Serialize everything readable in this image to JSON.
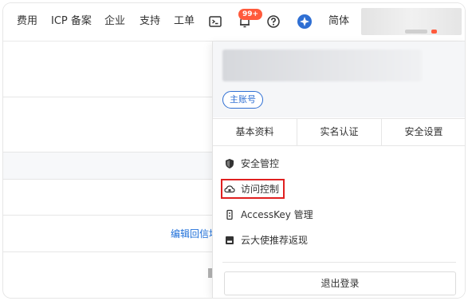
{
  "topbar": {
    "nav": [
      "费用",
      "ICP 备案",
      "企业",
      "支持",
      "工单"
    ],
    "icons": [
      "terminal-icon",
      "bell-icon",
      "help-icon",
      "app-logo-icon"
    ],
    "notification_count": "99+",
    "language": "简体"
  },
  "background": {
    "link_text": "编辑回信地址"
  },
  "dropdown": {
    "account_tag": "主账号",
    "tabs": [
      "基本资料",
      "实名认证",
      "安全设置"
    ],
    "menu": [
      {
        "label": "安全管控",
        "icon": "shield-icon"
      },
      {
        "label": "访问控制",
        "icon": "cloud-lock-icon"
      },
      {
        "label": "AccessKey 管理",
        "icon": "key-icon"
      },
      {
        "label": "云大使推荐返现",
        "icon": "gift-icon"
      }
    ],
    "logout_label": "退出登录"
  },
  "colors": {
    "accent": "#2f6fd3",
    "badge": "#ff5a3c",
    "highlight_box": "#e02020",
    "link": "#1e6fd9"
  }
}
